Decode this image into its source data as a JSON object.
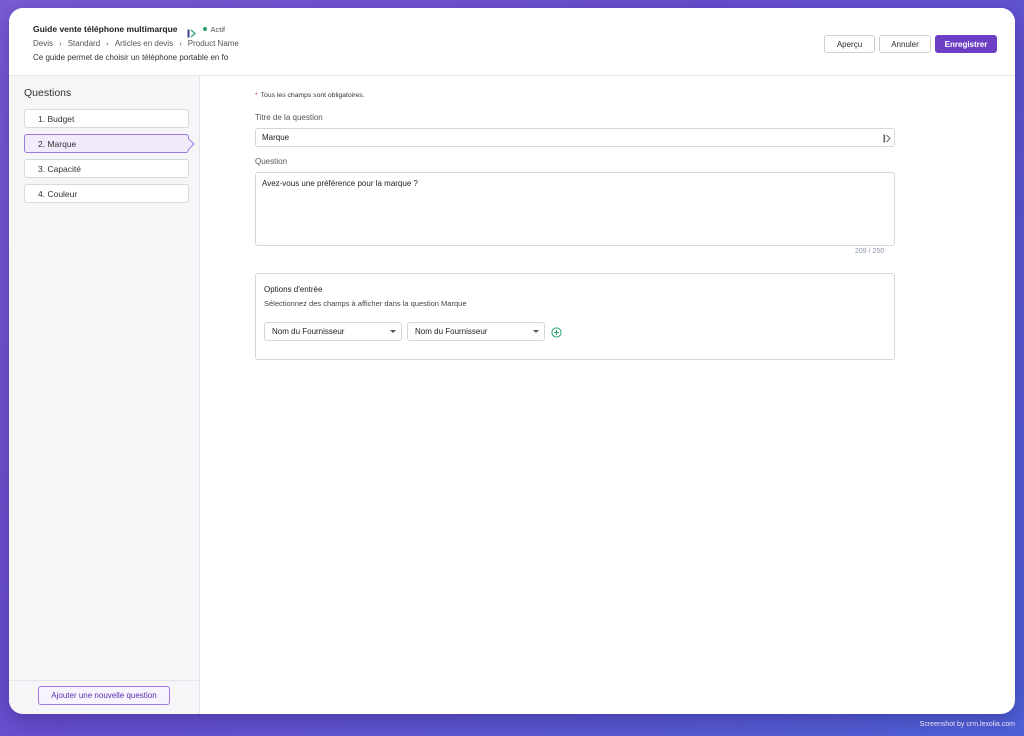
{
  "header": {
    "title": "Guide vente téléphone multimarque",
    "status": "Actif",
    "breadcrumb": [
      "Devis",
      "Standard",
      "Articles en devis",
      "Product Name"
    ],
    "subtitle": "Ce guide permet de choisir un téléphone portable en fo",
    "buttons": {
      "preview": "Aperçu",
      "cancel": "Annuler",
      "save": "Enregistrer"
    }
  },
  "sidebar": {
    "title": "Questions",
    "items": [
      {
        "label": "1.  Budget"
      },
      {
        "label": "2.  Marque"
      },
      {
        "label": "3.  Capacité"
      },
      {
        "label": "4.  Couleur"
      }
    ],
    "active_index": 1,
    "add_button": "Ajouter une nouvelle question"
  },
  "form": {
    "required_note": "Tous les champs sont obligatoires.",
    "title_label": "Titre de la question",
    "title_value": "Marque",
    "question_label": "Question",
    "question_value": "Avez-vous une préférence pour la marque ?",
    "counter": "209 / 250",
    "options": {
      "title": "Options d'entrée",
      "description": "Sélectionnez des champs à afficher dans la question Marque",
      "selects": [
        "Nom du Fournisseur",
        "Nom du Fournisseur"
      ]
    }
  },
  "watermark": "Screenshot by crm.lexolia.com",
  "colors": {
    "accent": "#6c3fc4",
    "status": "#2ba36b",
    "add_icon": "#2ba36b"
  },
  "icons": {
    "title_icon": "flow-icon",
    "add_option": "plus-circle-icon"
  }
}
